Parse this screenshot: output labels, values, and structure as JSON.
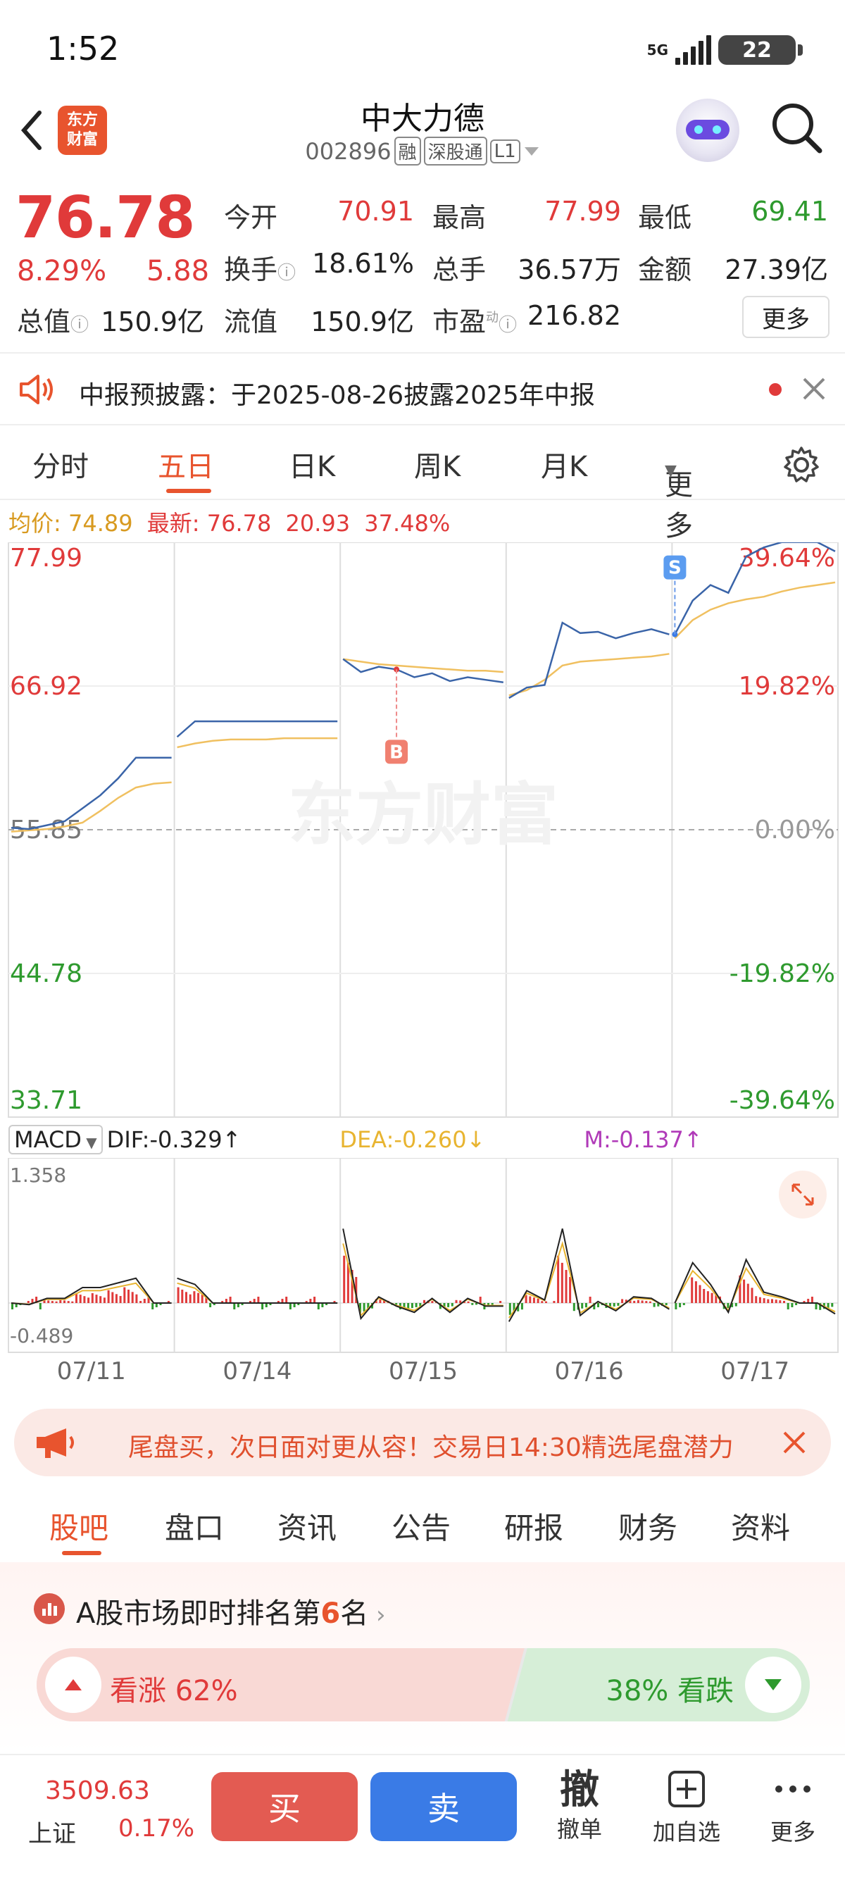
{
  "status": {
    "time": "1:52",
    "network": "5G",
    "battery": "22"
  },
  "header": {
    "logo_line1": "东方",
    "logo_line2": "财富",
    "stock_name": "中大力德",
    "stock_code": "002896",
    "tags": [
      "融",
      "深股通",
      "L1"
    ]
  },
  "quote": {
    "price": "76.78",
    "change_pct": "8.29%",
    "change_amt": "5.88",
    "open_label": "今开",
    "open": "70.91",
    "high_label": "最高",
    "high": "77.99",
    "low_label": "最低",
    "low": "69.41",
    "turnover_label": "换手",
    "turnover": "18.61%",
    "volume_label": "总手",
    "volume": "36.57万",
    "amount_label": "金额",
    "amount": "27.39亿",
    "mktcap_label": "总值",
    "mktcap": "150.9亿",
    "float_label": "流值",
    "float_cap": "150.9亿",
    "pe_label": "市盈",
    "pe_sup": "动",
    "pe": "216.82",
    "more": "更多"
  },
  "notice": {
    "text": "中报预披露：于2025-08-26披露2025年中报"
  },
  "tabs": [
    "分时",
    "五日",
    "日K",
    "周K",
    "月K",
    "更多"
  ],
  "active_tab": "五日",
  "chart_info": {
    "avg_label": "均价:",
    "avg": "74.89",
    "latest_label": "最新:",
    "latest": "76.78",
    "chg": "20.93",
    "pct": "37.48%"
  },
  "chart_data": {
    "type": "line",
    "x_labels": [
      "07/11",
      "07/14",
      "07/15",
      "07/16",
      "07/17"
    ],
    "y_left_ticks": [
      "77.99",
      "66.92",
      "55.85",
      "44.78",
      "33.71"
    ],
    "y_right_ticks": [
      "39.64%",
      "19.82%",
      "0.00%",
      "-19.82%",
      "-39.64%"
    ],
    "ylim": [
      33.71,
      77.99
    ],
    "base_price": 55.85,
    "watermark": "东方财富",
    "markers": [
      {
        "label": "B",
        "day": "07/15"
      },
      {
        "label": "S",
        "day": "07/17"
      }
    ],
    "series": [
      {
        "name": "price",
        "values": [
          56.0,
          55.9,
          56.2,
          56.5,
          57.5,
          58.5,
          59.8,
          61.4,
          61.4,
          61.4,
          63.0,
          64.2,
          64.2,
          64.2,
          64.2,
          64.2,
          64.2,
          64.2,
          64.2,
          64.2,
          69.0,
          68.0,
          68.4,
          68.2,
          67.6,
          67.9,
          67.3,
          67.6,
          67.4,
          67.2,
          66.0,
          66.8,
          67.0,
          71.8,
          71.0,
          71.1,
          70.6,
          71.0,
          71.3,
          70.9,
          70.9,
          73.5,
          74.7,
          74.1,
          76.9,
          77.6,
          78.0,
          78.0,
          78.0,
          77.3
        ]
      },
      {
        "name": "avg",
        "values": [
          55.7,
          55.8,
          55.9,
          56.1,
          56.4,
          57.3,
          58.3,
          59.1,
          59.4,
          59.5,
          62.2,
          62.5,
          62.7,
          62.8,
          62.8,
          62.8,
          62.9,
          62.9,
          62.9,
          62.9,
          69.0,
          68.8,
          68.6,
          68.5,
          68.4,
          68.3,
          68.2,
          68.1,
          68.1,
          68.0,
          66.2,
          66.6,
          67.4,
          68.5,
          68.8,
          68.9,
          69.0,
          69.1,
          69.2,
          69.4,
          70.6,
          72.0,
          72.8,
          73.3,
          73.6,
          73.8,
          74.2,
          74.5,
          74.7,
          74.9
        ]
      }
    ]
  },
  "macd": {
    "label": "MACD",
    "dif": "DIF:-0.329↑",
    "dea": "DEA:-0.260↓",
    "m": "M:-0.137↑",
    "ymax": "1.358",
    "ymin": "-0.489"
  },
  "promo": {
    "text": "尾盘买，次日面对更从容！交易日14:30精选尾盘潜力"
  },
  "subtabs": [
    "股吧",
    "盘口",
    "资讯",
    "公告",
    "研报",
    "财务",
    "资料"
  ],
  "rank": {
    "prefix": "A股市场即时排名第",
    "num": "6",
    "suffix": "名"
  },
  "vote": {
    "up_label": "看涨",
    "up_pct": "62%",
    "down_pct": "38%",
    "down_label": "看跌",
    "up_share": 0.62
  },
  "bottom": {
    "index_value": "3509.63",
    "index_name": "上证",
    "index_pct": "0.17%",
    "buy": "买",
    "sell": "卖",
    "cancel_icon": "撤",
    "cancel": "撤单",
    "add": "加自选",
    "more": "更多"
  },
  "colors": {
    "up": "#e03a3a",
    "down": "#2e9a2e",
    "accent": "#e8542e",
    "price_line": "#3a64a8",
    "avg_line": "#f0c060"
  }
}
